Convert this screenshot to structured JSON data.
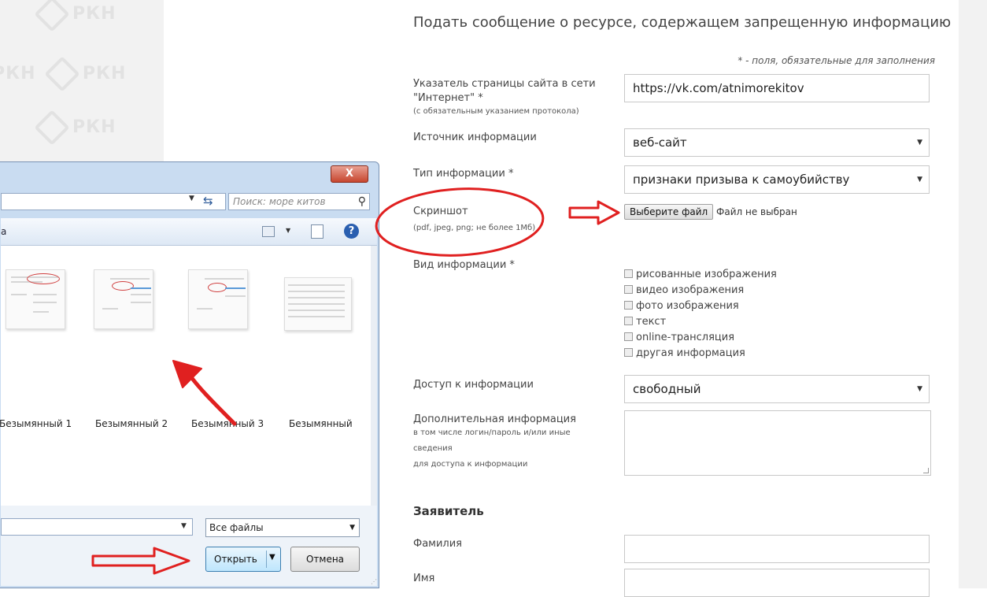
{
  "watermark": {
    "text": "РКН"
  },
  "form": {
    "title": "Подать сообщение о ресурсе, содержащем запрещенную информацию",
    "required_note": "* - поля, обязательные для заполнения",
    "url_label_line1": "Указатель страницы сайта в сети",
    "url_label_line2": "\"Интернет\" *",
    "url_label_sub": "(с обязательным указанием протокола)",
    "url_value": "https://vk.com/atnimorekitov",
    "source_label": "Источник информации",
    "source_value": "веб-сайт",
    "type_label": "Тип информации *",
    "type_value": "признаки призыва к самоубийству",
    "screenshot_label": "Скриншот",
    "screenshot_sub": "(pdf, jpeg, png; не более 1Мб)",
    "file_button": "Выберите файл",
    "file_status": "Файл не выбран",
    "kind_label": "Вид информации *",
    "kind_options": [
      "рисованные изображения",
      "видео изображения",
      "фото изображения",
      "текст",
      "online-трансляция",
      "другая информация"
    ],
    "access_label": "Доступ к информации",
    "access_value": "свободный",
    "extra_label": "Дополнительная информация",
    "extra_sub1": "в том числе логин/пароль и/или иные",
    "extra_sub2": "сведения",
    "extra_sub3": "для доступа к информации",
    "applicant_heading": "Заявитель",
    "lastname_label": "Фамилия",
    "firstname_label": "Имя"
  },
  "dialog": {
    "close_label": "X",
    "search_placeholder": "Поиск: море китов",
    "toolbar_label": "а",
    "help_label": "?",
    "files": [
      "Безымянный 1",
      "Безымянный 2",
      "Безымянный 3",
      "Безымянный"
    ],
    "filetype_value": "Все файлы",
    "open_label": "Открыть",
    "cancel_label": "Отмена"
  },
  "colors": {
    "annotation_red": "#e02020",
    "dialog_frame": "#c9dcf1"
  }
}
